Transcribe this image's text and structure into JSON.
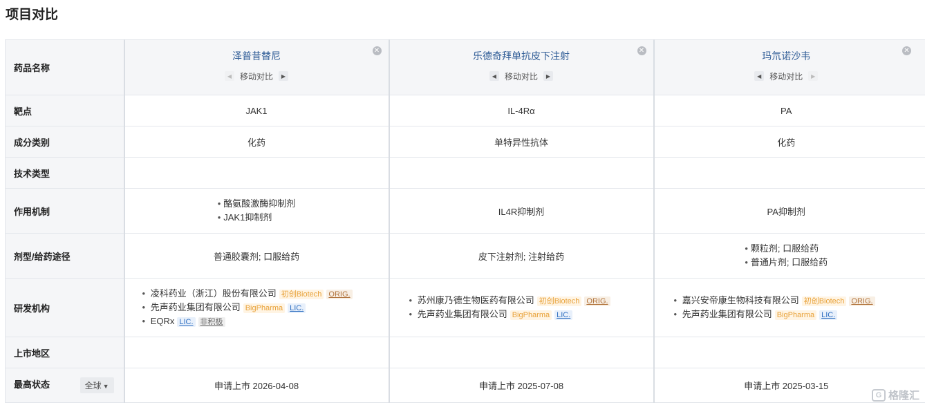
{
  "page": {
    "title": "项目对比"
  },
  "labels": {
    "drug_name": "药品名称",
    "target": "靶点",
    "composition": "成分类别",
    "tech_type": "技术类型",
    "mechanism": "作用机制",
    "formulation": "剂型/给药途径",
    "organization": "研发机构",
    "market_region": "上市地区",
    "highest_status": "最高状态",
    "scope_button": "全球"
  },
  "move_label": "移动对比",
  "drugs": [
    {
      "name": "泽普昔替尼",
      "target": "JAK1",
      "composition": "化药",
      "tech_type": "",
      "mechanism": [
        "酪氨酸激酶抑制剂",
        "JAK1抑制剂"
      ],
      "formulation": [
        "普通胶囊剂; 口服给药"
      ],
      "organizations": [
        {
          "name": "凌科药业（浙江）股份有限公司",
          "tags": [
            {
              "text": "初创Biotech",
              "kind": "bio"
            },
            {
              "text": "ORIG.",
              "kind": "orig"
            }
          ]
        },
        {
          "name": "先声药业集团有限公司",
          "tags": [
            {
              "text": "BigPharma",
              "kind": "bp"
            },
            {
              "text": "LIC.",
              "kind": "lic"
            }
          ]
        },
        {
          "name": "EQRx",
          "tags": [
            {
              "text": "LIC.",
              "kind": "lic"
            },
            {
              "text": "非积极",
              "kind": "inact"
            }
          ]
        }
      ],
      "market_region": "",
      "status": "申请上市 2026-04-08"
    },
    {
      "name": "乐德奇拜单抗皮下注射",
      "target": "IL-4Rα",
      "composition": "单特异性抗体",
      "tech_type": "",
      "mechanism": [
        "IL4R抑制剂"
      ],
      "formulation": [
        "皮下注射剂; 注射给药"
      ],
      "organizations": [
        {
          "name": "苏州康乃德生物医药有限公司",
          "tags": [
            {
              "text": "初创Biotech",
              "kind": "bio"
            },
            {
              "text": "ORIG.",
              "kind": "orig"
            }
          ]
        },
        {
          "name": "先声药业集团有限公司",
          "tags": [
            {
              "text": "BigPharma",
              "kind": "bp"
            },
            {
              "text": "LIC.",
              "kind": "lic"
            }
          ]
        }
      ],
      "market_region": "",
      "status": "申请上市 2025-07-08"
    },
    {
      "name": "玛氘诺沙韦",
      "target": "PA",
      "composition": "化药",
      "tech_type": "",
      "mechanism": [
        "PA抑制剂"
      ],
      "formulation": [
        "颗粒剂; 口服给药",
        "普通片剂; 口服给药"
      ],
      "organizations": [
        {
          "name": "嘉兴安帝康生物科技有限公司",
          "tags": [
            {
              "text": "初创Biotech",
              "kind": "bio"
            },
            {
              "text": "ORIG.",
              "kind": "orig"
            }
          ]
        },
        {
          "name": "先声药业集团有限公司",
          "tags": [
            {
              "text": "BigPharma",
              "kind": "bp"
            },
            {
              "text": "LIC.",
              "kind": "lic"
            }
          ]
        }
      ],
      "market_region": "",
      "status": "申请上市 2025-03-15"
    }
  ],
  "watermark": {
    "text": "格隆汇",
    "logo": "G"
  }
}
